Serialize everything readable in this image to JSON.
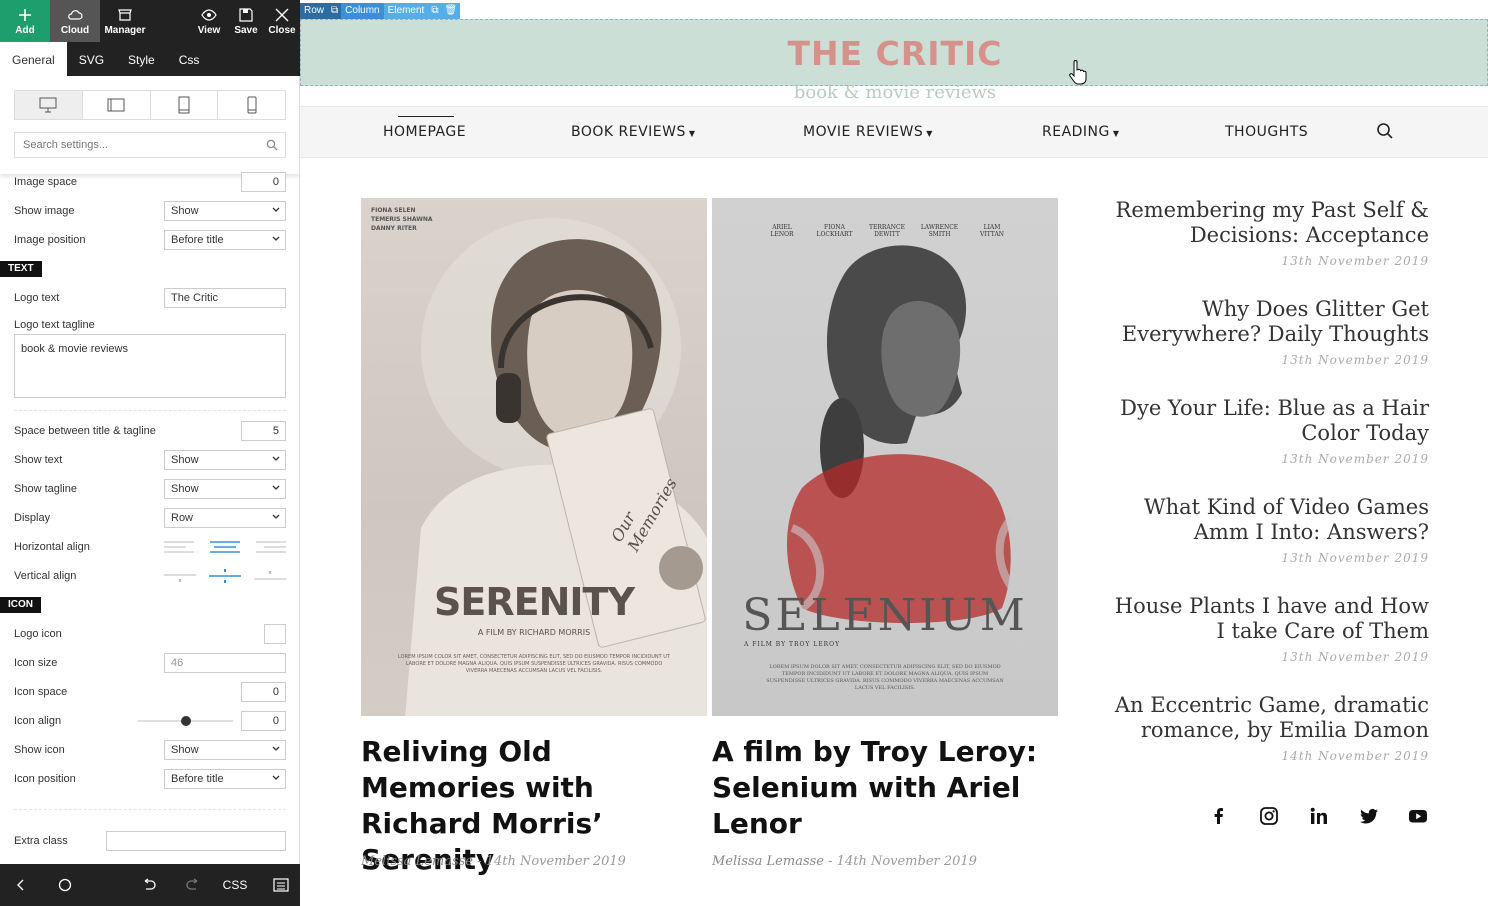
{
  "toolbar": {
    "add": "Add",
    "cloud": "Cloud",
    "manager": "Manager",
    "view": "View",
    "save": "Save",
    "close": "Close"
  },
  "tabs": [
    "General",
    "SVG",
    "Style",
    "Css"
  ],
  "search": {
    "placeholder": "Search settings..."
  },
  "settings": {
    "image_space": {
      "label": "Image space",
      "value": "0"
    },
    "show_image": {
      "label": "Show image",
      "value": "Show"
    },
    "image_position": {
      "label": "Image position",
      "value": "Before title"
    },
    "text_section": "TEXT",
    "logo_text": {
      "label": "Logo text",
      "value": "The Critic"
    },
    "logo_text_tagline": {
      "label": "Logo text tagline",
      "value": "book & movie reviews"
    },
    "space_title_tagline": {
      "label": "Space between title & tagline",
      "value": "5"
    },
    "show_text": {
      "label": "Show text",
      "value": "Show"
    },
    "show_tagline": {
      "label": "Show tagline",
      "value": "Show"
    },
    "display": {
      "label": "Display",
      "value": "Row"
    },
    "horizontal_align": {
      "label": "Horizontal align"
    },
    "vertical_align": {
      "label": "Vertical align"
    },
    "icon_section": "ICON",
    "logo_icon": {
      "label": "Logo icon"
    },
    "icon_size": {
      "label": "Icon size",
      "value": "46"
    },
    "icon_space": {
      "label": "Icon space",
      "value": "0"
    },
    "icon_align": {
      "label": "Icon align",
      "value": "0"
    },
    "show_icon": {
      "label": "Show icon",
      "value": "Show"
    },
    "icon_position": {
      "label": "Icon position",
      "value": "Before title"
    },
    "extra_class": {
      "label": "Extra class",
      "value": ""
    }
  },
  "bottombar": {
    "css": "CSS"
  },
  "builder_labels": {
    "row": "Row",
    "column": "Column",
    "element": "Element"
  },
  "site": {
    "logo": "THE CRITIC",
    "tagline": "book & movie reviews",
    "nav": [
      {
        "label": "HOMEPAGE"
      },
      {
        "label": "BOOK REVIEWS"
      },
      {
        "label": "MOVIE REVIEWS"
      },
      {
        "label": "READING"
      },
      {
        "label": "THOUGHTS"
      }
    ],
    "posters": [
      {
        "credits": "FIONA SELEN\nTEMERIS SHAWNA\nDANNY RITER",
        "book_text": "Our Memories",
        "big_title": "SERENITY",
        "subtitle": "A FILM BY RICHARD MORRIS",
        "fine": "LOREM IPSUM COLOR SIT AMET, CONSECTETUR ADIPISCING ELIT, SED DO EIUSMOD TEMPOR INCIDIDUNT UT LABORE ET DOLORE MAGNA ALIQUA. QUIS IPSUM SUSPENDISSE ULTRICES GRAVIDA. RISUS COMMODO VIVERRA MAECENAS ACCUMSAN LACUS VEL FACILISIS."
      },
      {
        "credits": [
          "ARIEL LENOR",
          "FIONA LOCKHART",
          "TERRANCE DEWITT",
          "LAWRENCE SMITH",
          "LIAM VITTAN"
        ],
        "big_title": "SELENIUM",
        "subtitle": "A FILM BY TROY LEROY",
        "fine": "LOREM IPSUM DOLOR SIT AMET, CONSECTETUR ADIPISCING ELIT, SED DO EIUSMOD TEMPOR INCIDIDUNT UT LABORE ET DOLORE MAGNA ALIQUA. QUIS IPSUM SUSPENDISSE ULTRICES GRAVIDA. RISUS COMMODO VIVERRA MAECENAS ACCUMSAN LACUS VEL FACILISIS."
      }
    ],
    "posts": [
      {
        "title": "Reliving Old Memories with Richard Morris’ Serenity",
        "author": "Melissa Lemasse",
        "date": "14th November 2019"
      },
      {
        "title": "A film by Troy Leroy: Selenium with Ariel Lenor",
        "author": "Melissa Lemasse",
        "date": "14th November 2019"
      }
    ],
    "sidebar": [
      {
        "title": "Remembering my Past Self & Decisions: Acceptance",
        "date": "13th November 2019"
      },
      {
        "title": "Why Does Glitter Get Everywhere? Daily Thoughts",
        "date": "13th November 2019"
      },
      {
        "title": "Dye Your Life: Blue as a Hair Color Today",
        "date": "13th November 2019"
      },
      {
        "title": "What Kind of Video Games Amm I Into: Answers?",
        "date": "13th November 2019"
      },
      {
        "title": "House Plants I have and How I take Care of Them",
        "date": "13th November 2019"
      },
      {
        "title": "An Eccentric Game, dramatic romance, by Emilia Damon",
        "date": "14th November 2019"
      }
    ],
    "social": [
      "facebook-icon",
      "instagram-icon",
      "linkedin-icon",
      "twitter-icon",
      "youtube-icon"
    ]
  },
  "colors": {
    "accent": "#1e9e6c",
    "logo": "#d6928a",
    "header_bg": "#cbdfd6",
    "toolbar": "#222222"
  }
}
